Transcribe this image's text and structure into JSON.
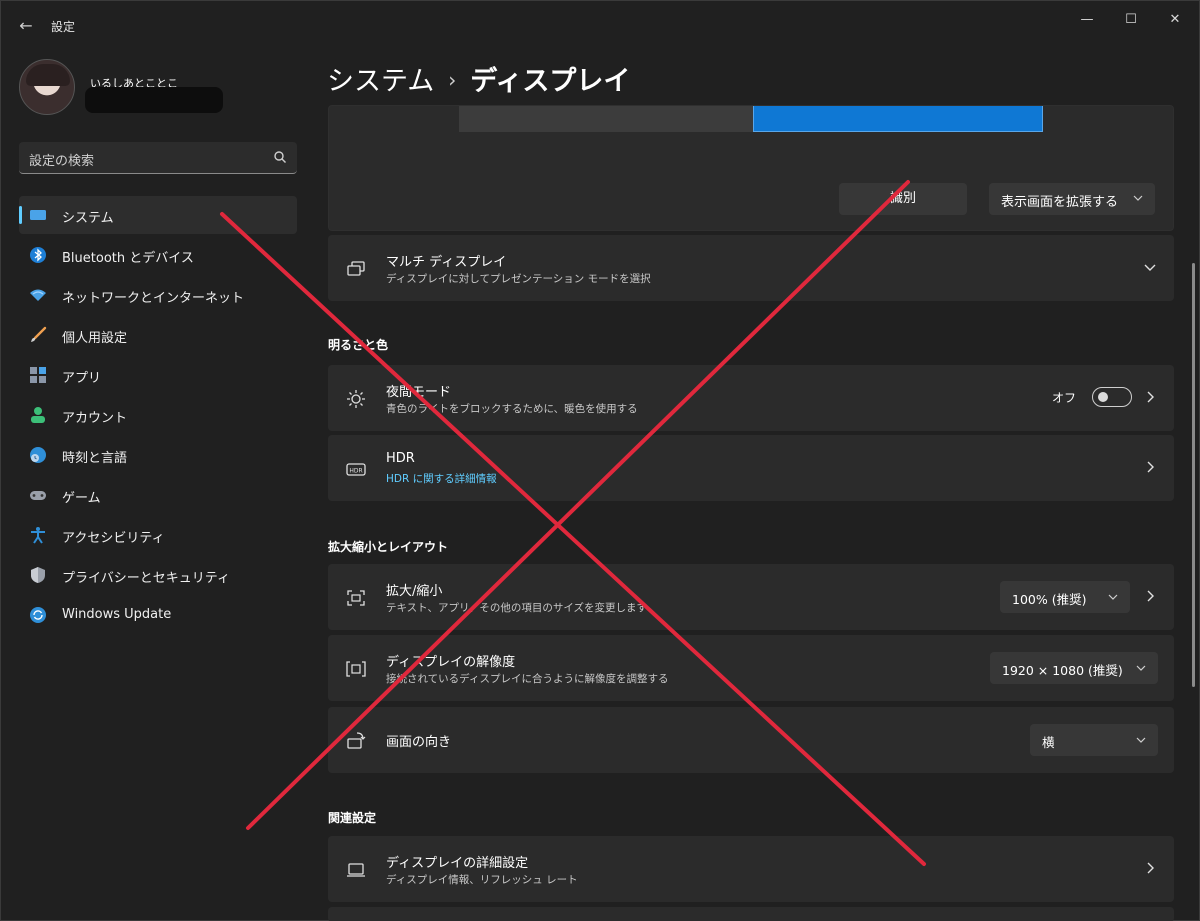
{
  "window": {
    "app_title": "設定",
    "back_glyph": "←",
    "min_glyph": "—",
    "max_glyph": "☐",
    "close_glyph": "✕"
  },
  "profile": {
    "name": "いるしあとことこ"
  },
  "search": {
    "placeholder": "設定の検索"
  },
  "sidebar": {
    "items": [
      {
        "label": "システム",
        "icon": "monitor-icon",
        "active": true
      },
      {
        "label": "Bluetooth とデバイス",
        "icon": "bluetooth-icon"
      },
      {
        "label": "ネットワークとインターネット",
        "icon": "wifi-icon"
      },
      {
        "label": "個人用設定",
        "icon": "brush-icon"
      },
      {
        "label": "アプリ",
        "icon": "apps-icon"
      },
      {
        "label": "アカウント",
        "icon": "person-icon"
      },
      {
        "label": "時刻と言語",
        "icon": "globe-clock-icon"
      },
      {
        "label": "ゲーム",
        "icon": "gamepad-icon"
      },
      {
        "label": "アクセシビリティ",
        "icon": "accessibility-icon"
      },
      {
        "label": "プライバシーとセキュリティ",
        "icon": "shield-icon"
      },
      {
        "label": "Windows Update",
        "icon": "update-icon"
      }
    ]
  },
  "breadcrumb": {
    "parent": "システム",
    "separator": "›",
    "current": "ディスプレイ"
  },
  "display_arrangement": {
    "identify_label": "識別",
    "extend_label": "表示画面を拡張する"
  },
  "multi_display": {
    "title": "マルチ ディスプレイ",
    "subtitle": "ディスプレイに対してプレゼンテーション モードを選択"
  },
  "sections": {
    "brightness": "明るさと色",
    "scale_layout": "拡大縮小とレイアウト",
    "related": "関連設定"
  },
  "night_light": {
    "title": "夜間モード",
    "subtitle": "青色のライトをブロックするために、暖色を使用する",
    "toggle_label": "オフ",
    "toggle_on": false
  },
  "hdr": {
    "title": "HDR",
    "subtitle": "HDR に関する詳細情報"
  },
  "scale": {
    "title": "拡大/縮小",
    "subtitle": "テキスト、アプリ、その他の項目のサイズを変更します",
    "value": "100% (推奨)"
  },
  "resolution": {
    "title": "ディスプレイの解像度",
    "subtitle": "接続されているディスプレイに合うように解像度を調整する",
    "value": "1920 × 1080 (推奨)"
  },
  "orientation": {
    "title": "画面の向き",
    "value": "横"
  },
  "advanced_display": {
    "title": "ディスプレイの詳細設定",
    "subtitle": "ディスプレイ情報、リフレッシュ レート"
  },
  "colors": {
    "background": "#202020",
    "card": "#2b2b2b",
    "accent": "#60cdff",
    "overlay_x": "#e0283c"
  }
}
